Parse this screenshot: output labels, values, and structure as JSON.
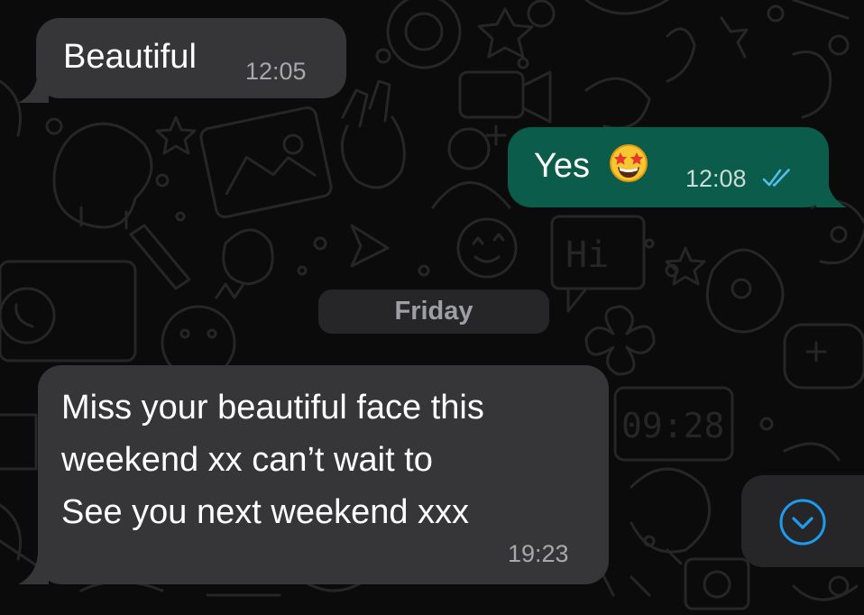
{
  "chat": {
    "messages": [
      {
        "direction": "incoming",
        "text": "Beautiful",
        "time": "12:05"
      },
      {
        "direction": "outgoing",
        "text": "Yes",
        "emoji": "star-struck-emoji",
        "time": "12:08",
        "status": "read"
      },
      {
        "direction": "incoming",
        "text": "Miss your beautiful face this\nweekend xx can’t wait to\nSee you next weekend xxx",
        "time": "19:23"
      }
    ],
    "date_separator": "Friday"
  },
  "scroll_button": {
    "icon": "chevron-down-circle-icon"
  },
  "wallpaper": {
    "clock_text": "09:28",
    "sign_text": "Hi"
  },
  "colors": {
    "background": "#0b0b0b",
    "incoming_bubble": "#363638",
    "outgoing_bubble": "#0b5c4b",
    "read_ticks": "#53bdeb",
    "date_chip": "#262628"
  }
}
